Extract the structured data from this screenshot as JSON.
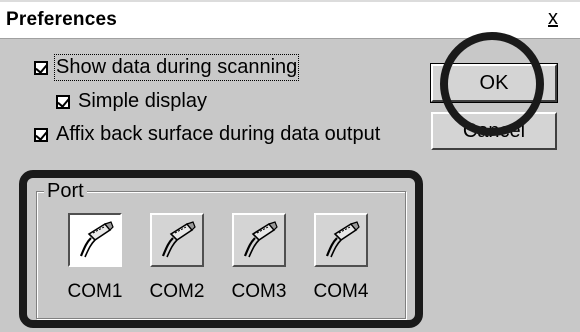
{
  "window": {
    "title": "Preferences",
    "close_label": "x"
  },
  "options": {
    "show_data": {
      "label": "Show data during scanning",
      "checked": true
    },
    "simple_display": {
      "label": "Simple display",
      "checked": true
    },
    "affix_back": {
      "label": "Affix back surface during data output",
      "checked": true
    }
  },
  "buttons": {
    "ok_label": "OK",
    "cancel_label": "Cancel"
  },
  "port": {
    "legend": "Port",
    "selected": "COM1",
    "items": [
      {
        "label": "COM1",
        "icon": "serial-cable-icon"
      },
      {
        "label": "COM2",
        "icon": "serial-cable-icon"
      },
      {
        "label": "COM3",
        "icon": "serial-cable-icon"
      },
      {
        "label": "COM4",
        "icon": "serial-cable-icon"
      }
    ]
  },
  "annotations": {
    "highlight_color": "#1a1a1a"
  }
}
